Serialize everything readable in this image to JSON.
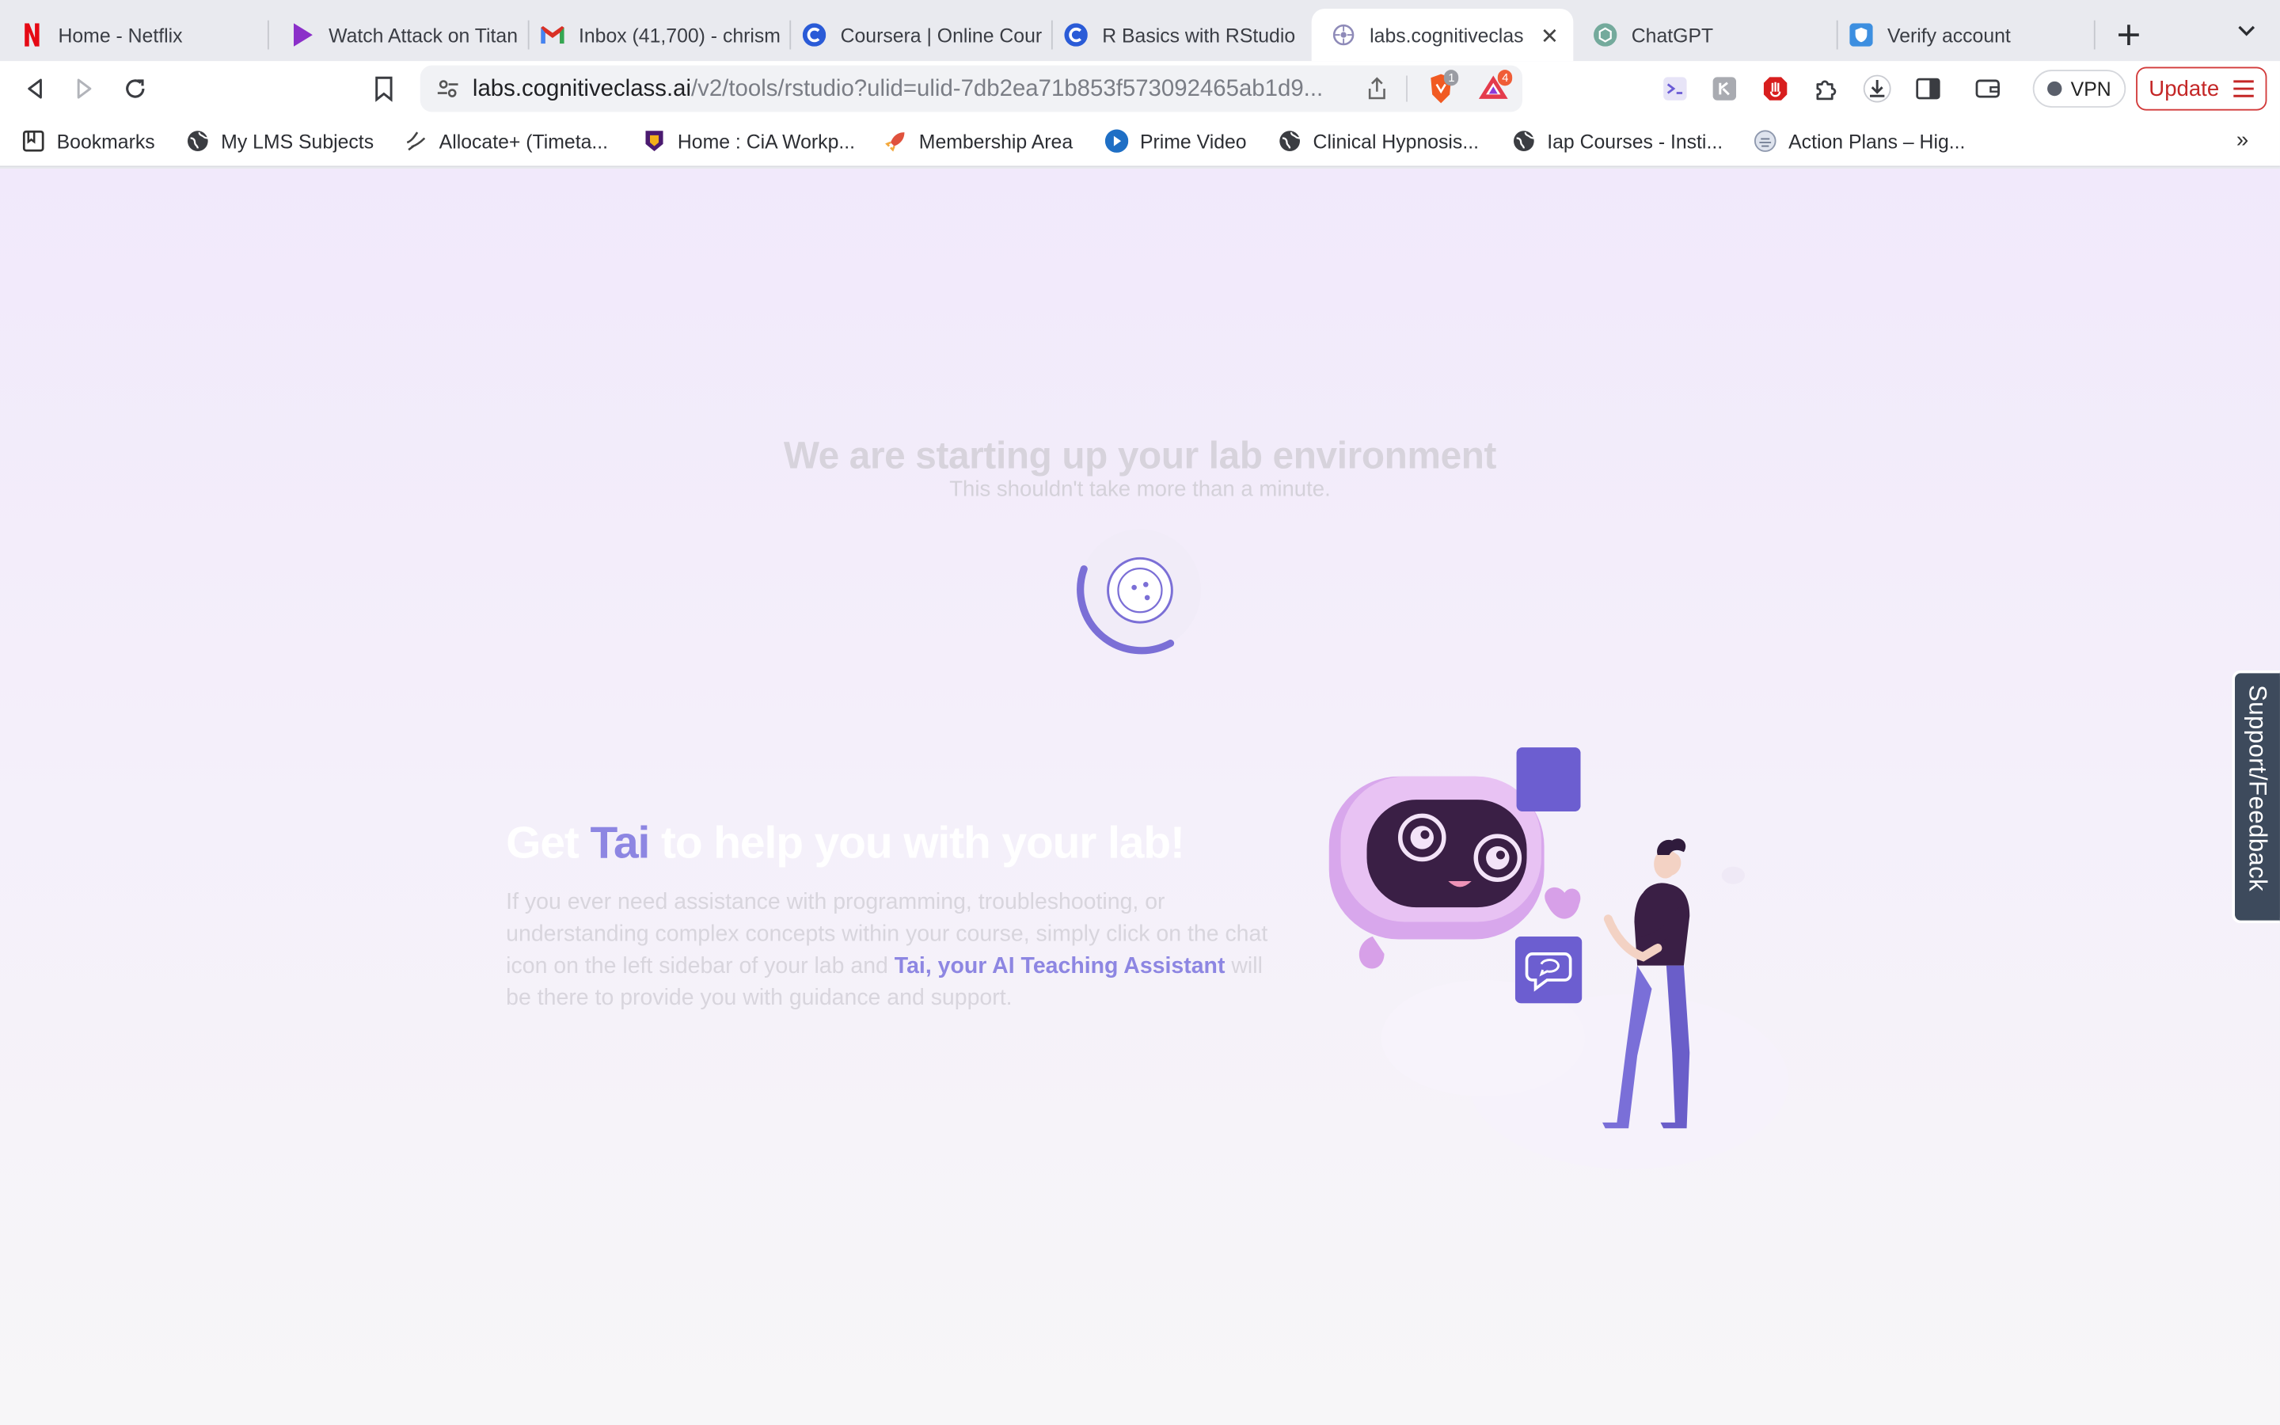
{
  "tabs": [
    {
      "label": "Home - Netflix",
      "icon": "netflix-icon"
    },
    {
      "label": "Watch Attack on Titan",
      "icon": "play-icon"
    },
    {
      "label": "Inbox (41,700) - chrism",
      "icon": "gmail-icon"
    },
    {
      "label": "Coursera | Online Cour",
      "icon": "coursera-icon"
    },
    {
      "label": "R Basics with RStudio",
      "icon": "coursera-icon"
    },
    {
      "label": "labs.cognitiveclas",
      "icon": "cognitiveclass-icon",
      "active": true
    },
    {
      "label": "ChatGPT",
      "icon": "chatgpt-icon"
    },
    {
      "label": "Verify account",
      "icon": "shield-icon"
    }
  ],
  "toolbar": {
    "url_host": "labs.cognitiveclass.ai",
    "url_path": "/v2/tools/rstudio?ulid=ulid-7db2ea71b853f573092465ab1d9...",
    "brave_shields_count": "1",
    "rewards_count": "4",
    "vpn_label": "VPN",
    "update_label": "Update"
  },
  "bookmarks": [
    {
      "label": "Bookmarks",
      "icon": "bookmarks-icon"
    },
    {
      "label": "My LMS Subjects",
      "icon": "globe-icon"
    },
    {
      "label": "Allocate+ (Timeta...",
      "icon": "allocate-icon"
    },
    {
      "label": "Home : CiA Workp...",
      "icon": "cia-icon"
    },
    {
      "label": "Membership Area",
      "icon": "rocket-icon"
    },
    {
      "label": "Prime Video",
      "icon": "prime-video-icon"
    },
    {
      "label": "Clinical Hypnosis...",
      "icon": "globe-icon"
    },
    {
      "label": "Iap Courses - Insti...",
      "icon": "globe-icon"
    },
    {
      "label": "Action Plans – Hig...",
      "icon": "action-plans-icon"
    }
  ],
  "page": {
    "headline": "We are starting up your lab environment",
    "subline": "This shouldn't take more than a minute.",
    "promo_title_pre": "Get ",
    "promo_title_tai": "Tai",
    "promo_title_post": " to help you with your lab!",
    "promo_body_1": "If you ever need assistance with programming, troubleshooting, or understanding complex concepts within your course, simply click on the chat icon on the left sidebar of your lab and ",
    "promo_body_highlight": "Tai, your AI Teaching Assistant",
    "promo_body_2": " will be there to provide you with guidance and support."
  },
  "feedback_tab": "Support/Feedback",
  "colors": {
    "accent": "#8d86e2",
    "spinner": "#7b6fd6",
    "update_red": "#c42626",
    "feedback_bg": "#3d4a5c"
  }
}
